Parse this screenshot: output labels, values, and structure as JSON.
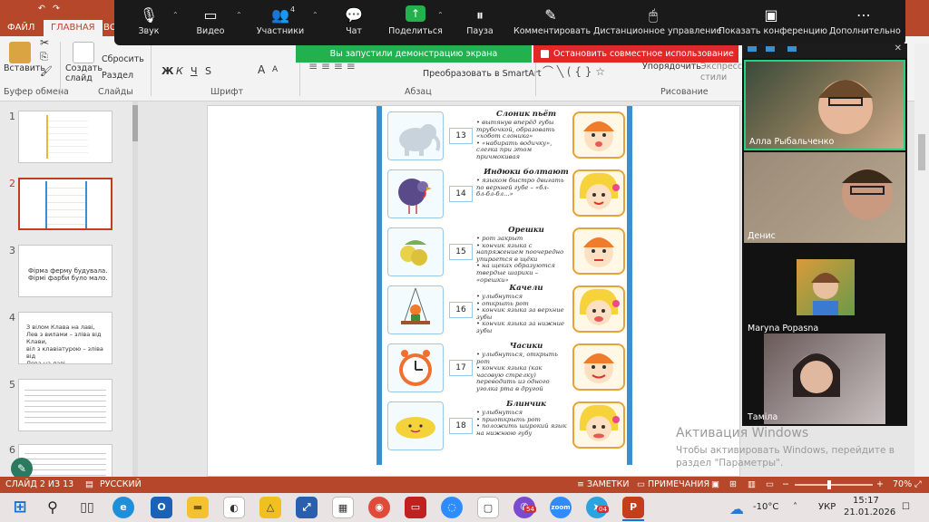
{
  "ppt": {
    "tabs": [
      "ФАЙЛ",
      "ГЛАВНАЯ",
      "ВС"
    ],
    "active_tab": "ГЛАВНАЯ",
    "ribbon": {
      "paste": "Вставить",
      "create_slide": "Создать\nслайд",
      "reset": "Сбросить",
      "section": "Раздел",
      "convert_smartart": "Преобразовать в SmartArt",
      "arrange": "Упорядочить",
      "express_styles": "Экспресс-\nстили",
      "bold": "Ж",
      "italic": "К",
      "underline": "Ч",
      "strike": "S",
      "font_size_up": "A",
      "font_size_down": "A",
      "groups": {
        "clipboard": "Буфер обмена",
        "slides": "Слайды",
        "font": "Шрифт",
        "paragraph": "Абзац",
        "drawing": "Рисование"
      }
    },
    "slides": [
      {
        "num": "1",
        "text": ""
      },
      {
        "num": "2",
        "text": ""
      },
      {
        "num": "3",
        "text": "Фірма ферму будувала.\nФірмі фарби було мало."
      },
      {
        "num": "4",
        "text": "З вілом Клава на лаві,\nЛев з вилами – зліва від\nКлави,\nвіл з клавіатурою – зліва від\nЛева на лаві."
      },
      {
        "num": "5",
        "text": ""
      },
      {
        "num": "6",
        "text": ""
      }
    ],
    "status": {
      "slide_info": "СЛАЙД 2 ИЗ 13",
      "language": "РУССКИЙ",
      "notes": "ЗАМЕТКИ",
      "comments": "ПРИМЕЧАНИЯ",
      "zoom_percent": "70%",
      "minus": "−",
      "plus": "+"
    }
  },
  "zoom": {
    "toolbar": [
      {
        "id": "audio",
        "label": "Звук",
        "icon": "mic-icon"
      },
      {
        "id": "video",
        "label": "Видео",
        "icon": "video-off-icon"
      },
      {
        "id": "participants",
        "label": "Участники",
        "icon": "participants-icon",
        "count": "4"
      },
      {
        "id": "chat",
        "label": "Чат",
        "icon": "chat-icon"
      },
      {
        "id": "share",
        "label": "Поделиться",
        "icon": "share-icon"
      },
      {
        "id": "pause",
        "label": "Пауза",
        "icon": "pause-icon"
      },
      {
        "id": "annotate",
        "label": "Комментировать",
        "icon": "pen-icon"
      },
      {
        "id": "remote",
        "label": "Дистанционное управление",
        "icon": "mouse-icon"
      },
      {
        "id": "show_conf",
        "label": "Показать конференцию",
        "icon": "screen-icon"
      },
      {
        "id": "more",
        "label": "Дополнительно",
        "icon": "more-icon"
      }
    ],
    "share_banner": "Вы запустили демонстрацию экрана",
    "stop_banner": "Остановить совместное использование",
    "participants": [
      {
        "name": "Алла Рыбальченко",
        "active": true
      },
      {
        "name": "Денис",
        "active": false
      },
      {
        "name": "Maryna Popasna",
        "active": false
      },
      {
        "name": "Таміла",
        "active": false
      }
    ]
  },
  "worksheet": {
    "exercises": [
      {
        "num": "13",
        "title": "Слоник пьёт",
        "text": "• вытянув вперёд губы\nтрубочкой, образовать\n«хобот слоника»\n• «набирать водичку»,\nслегка при этом\nпричмокивая",
        "picture": "elephant"
      },
      {
        "num": "14",
        "title": "Индюки болтают",
        "text": "• языком быстро двигать\nпо верхней губе – «бл-\nбл-бл-бл...»",
        "picture": "turkey"
      },
      {
        "num": "15",
        "title": "Орешки",
        "text": "• рот закрыт\n• кончик языка с\nнапряжением поочередно\nупирается в щёки\n• на щеках образуются\nтвердые шарики –\n«орешки»",
        "picture": "nuts"
      },
      {
        "num": "16",
        "title": "Качели",
        "text": "• улыбнуться\n• открыть рот\n• кончик языка за верхние\nзубы\n• кончик языка за нижние\nзубы",
        "picture": "swing"
      },
      {
        "num": "17",
        "title": "Часики",
        "text": "• улыбнуться, открыть\nрот\n• кончик языка (как\nчасовую стрелку)\nпереводить из одного\nуголка рта в другой",
        "picture": "clock"
      },
      {
        "num": "18",
        "title": "Блинчик",
        "text": "• улыбнуться\n• приоткрыть рот\n• положить широкий язык\nна нижнюю губу",
        "picture": "pancake"
      }
    ]
  },
  "windows": {
    "activation_title": "Активация Windows",
    "activation_text": "Чтобы активировать Windows, перейдите в раздел \"Параметры\".",
    "temperature": "-10°C",
    "language": "УКР",
    "time": "15:17",
    "date": "21.01.2026",
    "badges": {
      "viber": "54",
      "telegram": "04"
    }
  },
  "colors": {
    "ppt_accent": "#b7472a",
    "zoom_bar": "#1a1a1a",
    "share_green": "#23b14d",
    "stop_red": "#e02828",
    "active_speaker": "#26d07c"
  }
}
